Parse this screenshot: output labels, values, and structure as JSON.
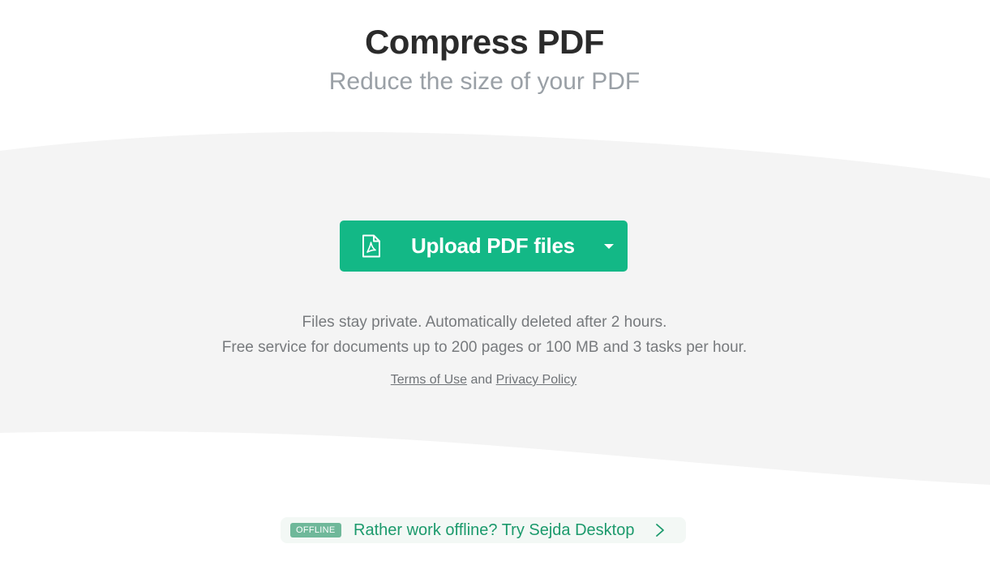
{
  "header": {
    "title": "Compress PDF",
    "subtitle": "Reduce the size of your PDF"
  },
  "upload": {
    "label": "Upload PDF files",
    "icon": "pdf-file-icon",
    "dropdown_icon": "caret-down-icon"
  },
  "info": {
    "line1": "Files stay private. Automatically deleted after 2 hours.",
    "line2": "Free service for documents up to 200 pages or 100 MB and 3 tasks per hour."
  },
  "legal": {
    "terms_label": "Terms of Use",
    "and_text": "and",
    "privacy_label": "Privacy Policy"
  },
  "offline": {
    "badge": "OFFLINE",
    "text": "Rather work offline? Try Sejda Desktop",
    "icon": "chevron-right-icon"
  },
  "colors": {
    "accent": "#13b886",
    "band": "#f4f4f4",
    "offline_text": "#1c9a6c",
    "badge": "#6fb89a"
  }
}
